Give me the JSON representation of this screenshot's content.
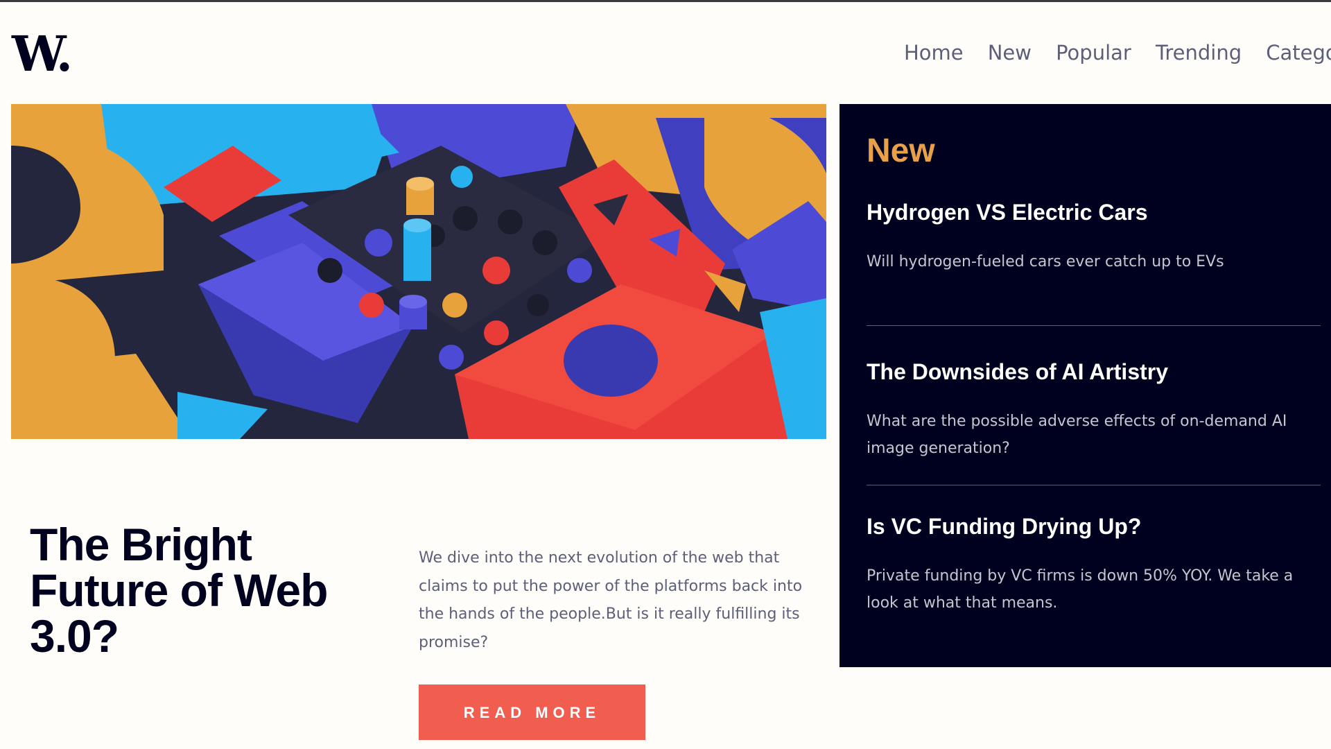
{
  "brand": {
    "logo_text": "W."
  },
  "nav": {
    "items": [
      {
        "label": "Home"
      },
      {
        "label": "New"
      },
      {
        "label": "Popular"
      },
      {
        "label": "Trending"
      },
      {
        "label": "Categories"
      }
    ]
  },
  "hero": {
    "title": "The Bright Future of Web 3.0?",
    "excerpt": "We dive into the next evolution of the web that claims to put the power of the platforms back into the hands of the people.But is it really fulfilling its promise?",
    "button_label": "READ MORE"
  },
  "new_panel": {
    "title": "New",
    "items": [
      {
        "title": "Hydrogen VS Electric Cars",
        "description": "Will hydrogen-fueled cars ever catch up to EVs"
      },
      {
        "title": "The Downsides of AI Artistry",
        "description": "What are the possible adverse effects of on-demand AI image generation?"
      },
      {
        "title": "Is VC Funding Drying Up?",
        "description": "Private funding by VC firms is down 50% YOY. We take a look at what that means."
      }
    ]
  },
  "colors": {
    "dark_navy": "#00011f",
    "accent_orange": "#e9a04a",
    "accent_red": "#f15e50",
    "text_gray": "#5d5f79",
    "page_background": "#fffdfa"
  }
}
